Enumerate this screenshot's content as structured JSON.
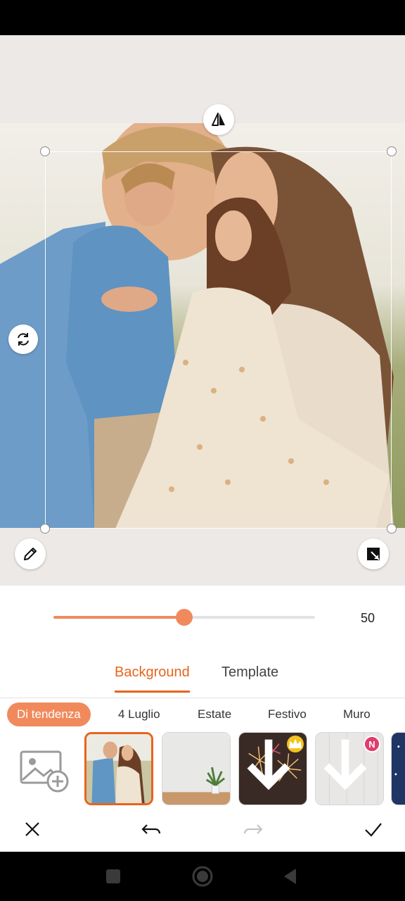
{
  "slider": {
    "value": 50,
    "fill_fraction": 0.5,
    "value_label": "50"
  },
  "tabs": [
    {
      "label": "Background",
      "active": true
    },
    {
      "label": "Template",
      "active": false
    }
  ],
  "categories": [
    {
      "label": "Di tendenza",
      "active": true
    },
    {
      "label": "4 Luglio",
      "active": false
    },
    {
      "label": "Estate",
      "active": false
    },
    {
      "label": "Festivo",
      "active": false
    },
    {
      "label": "Muro",
      "active": false
    }
  ],
  "thumbnails": [
    {
      "name": "couple-photo",
      "selected": true
    },
    {
      "name": "plant-room",
      "selected": false
    },
    {
      "name": "fireworks",
      "badge": "crown-icon",
      "download": true
    },
    {
      "name": "white-wood",
      "badge_text": "N",
      "download": true
    },
    {
      "name": "night-sky",
      "partial": true
    }
  ],
  "badges": {
    "new_text": "N"
  },
  "icons": {
    "flip": "flip-horizontal-icon",
    "rotate": "rotate-icon",
    "edit": "pencil-icon",
    "resize": "resize-corner-icon",
    "add_image": "add-image-icon",
    "close": "close-icon",
    "undo": "undo-icon",
    "redo": "redo-icon",
    "confirm": "check-icon"
  },
  "colors": {
    "accent": "#e8641c",
    "accent_light": "#f08a5d",
    "canvas_bg": "#ece9e6"
  }
}
